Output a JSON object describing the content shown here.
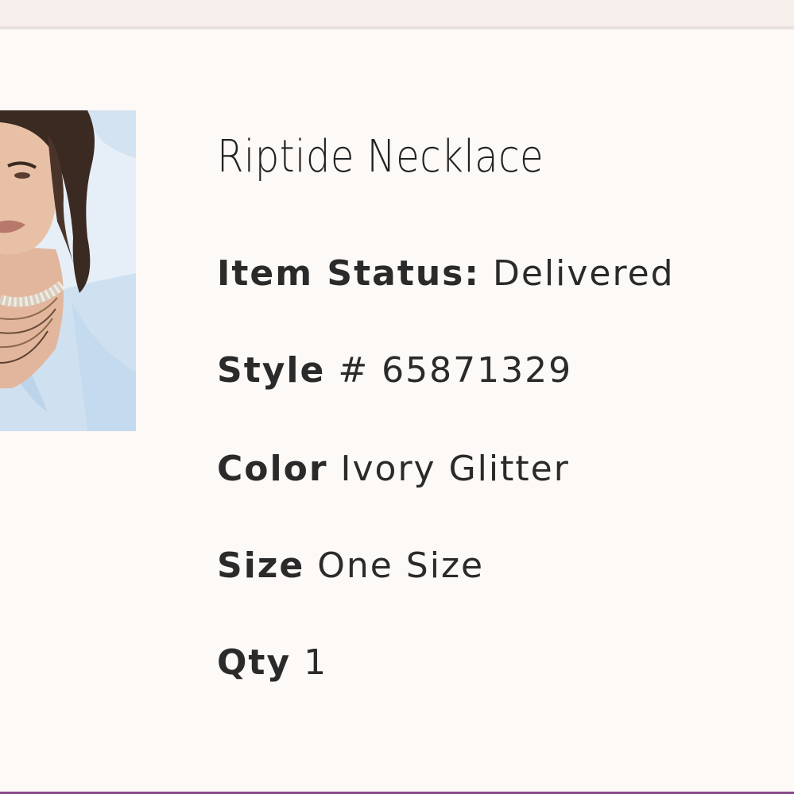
{
  "product": {
    "name": "Riptide Necklace",
    "status_label": "Item Status:",
    "status_value": "Delivered",
    "style_label": "Style",
    "style_value": "# 65871329",
    "color_label": "Color",
    "color_value": "Ivory Glitter",
    "size_label": "Size",
    "size_value": "One Size",
    "qty_label": "Qty",
    "qty_value": "1"
  },
  "colors": {
    "background": "#fdf9f7",
    "text": "#2a2a2a",
    "top_strip": "#f6efec",
    "bottom_accent": "#8a4a8a"
  }
}
